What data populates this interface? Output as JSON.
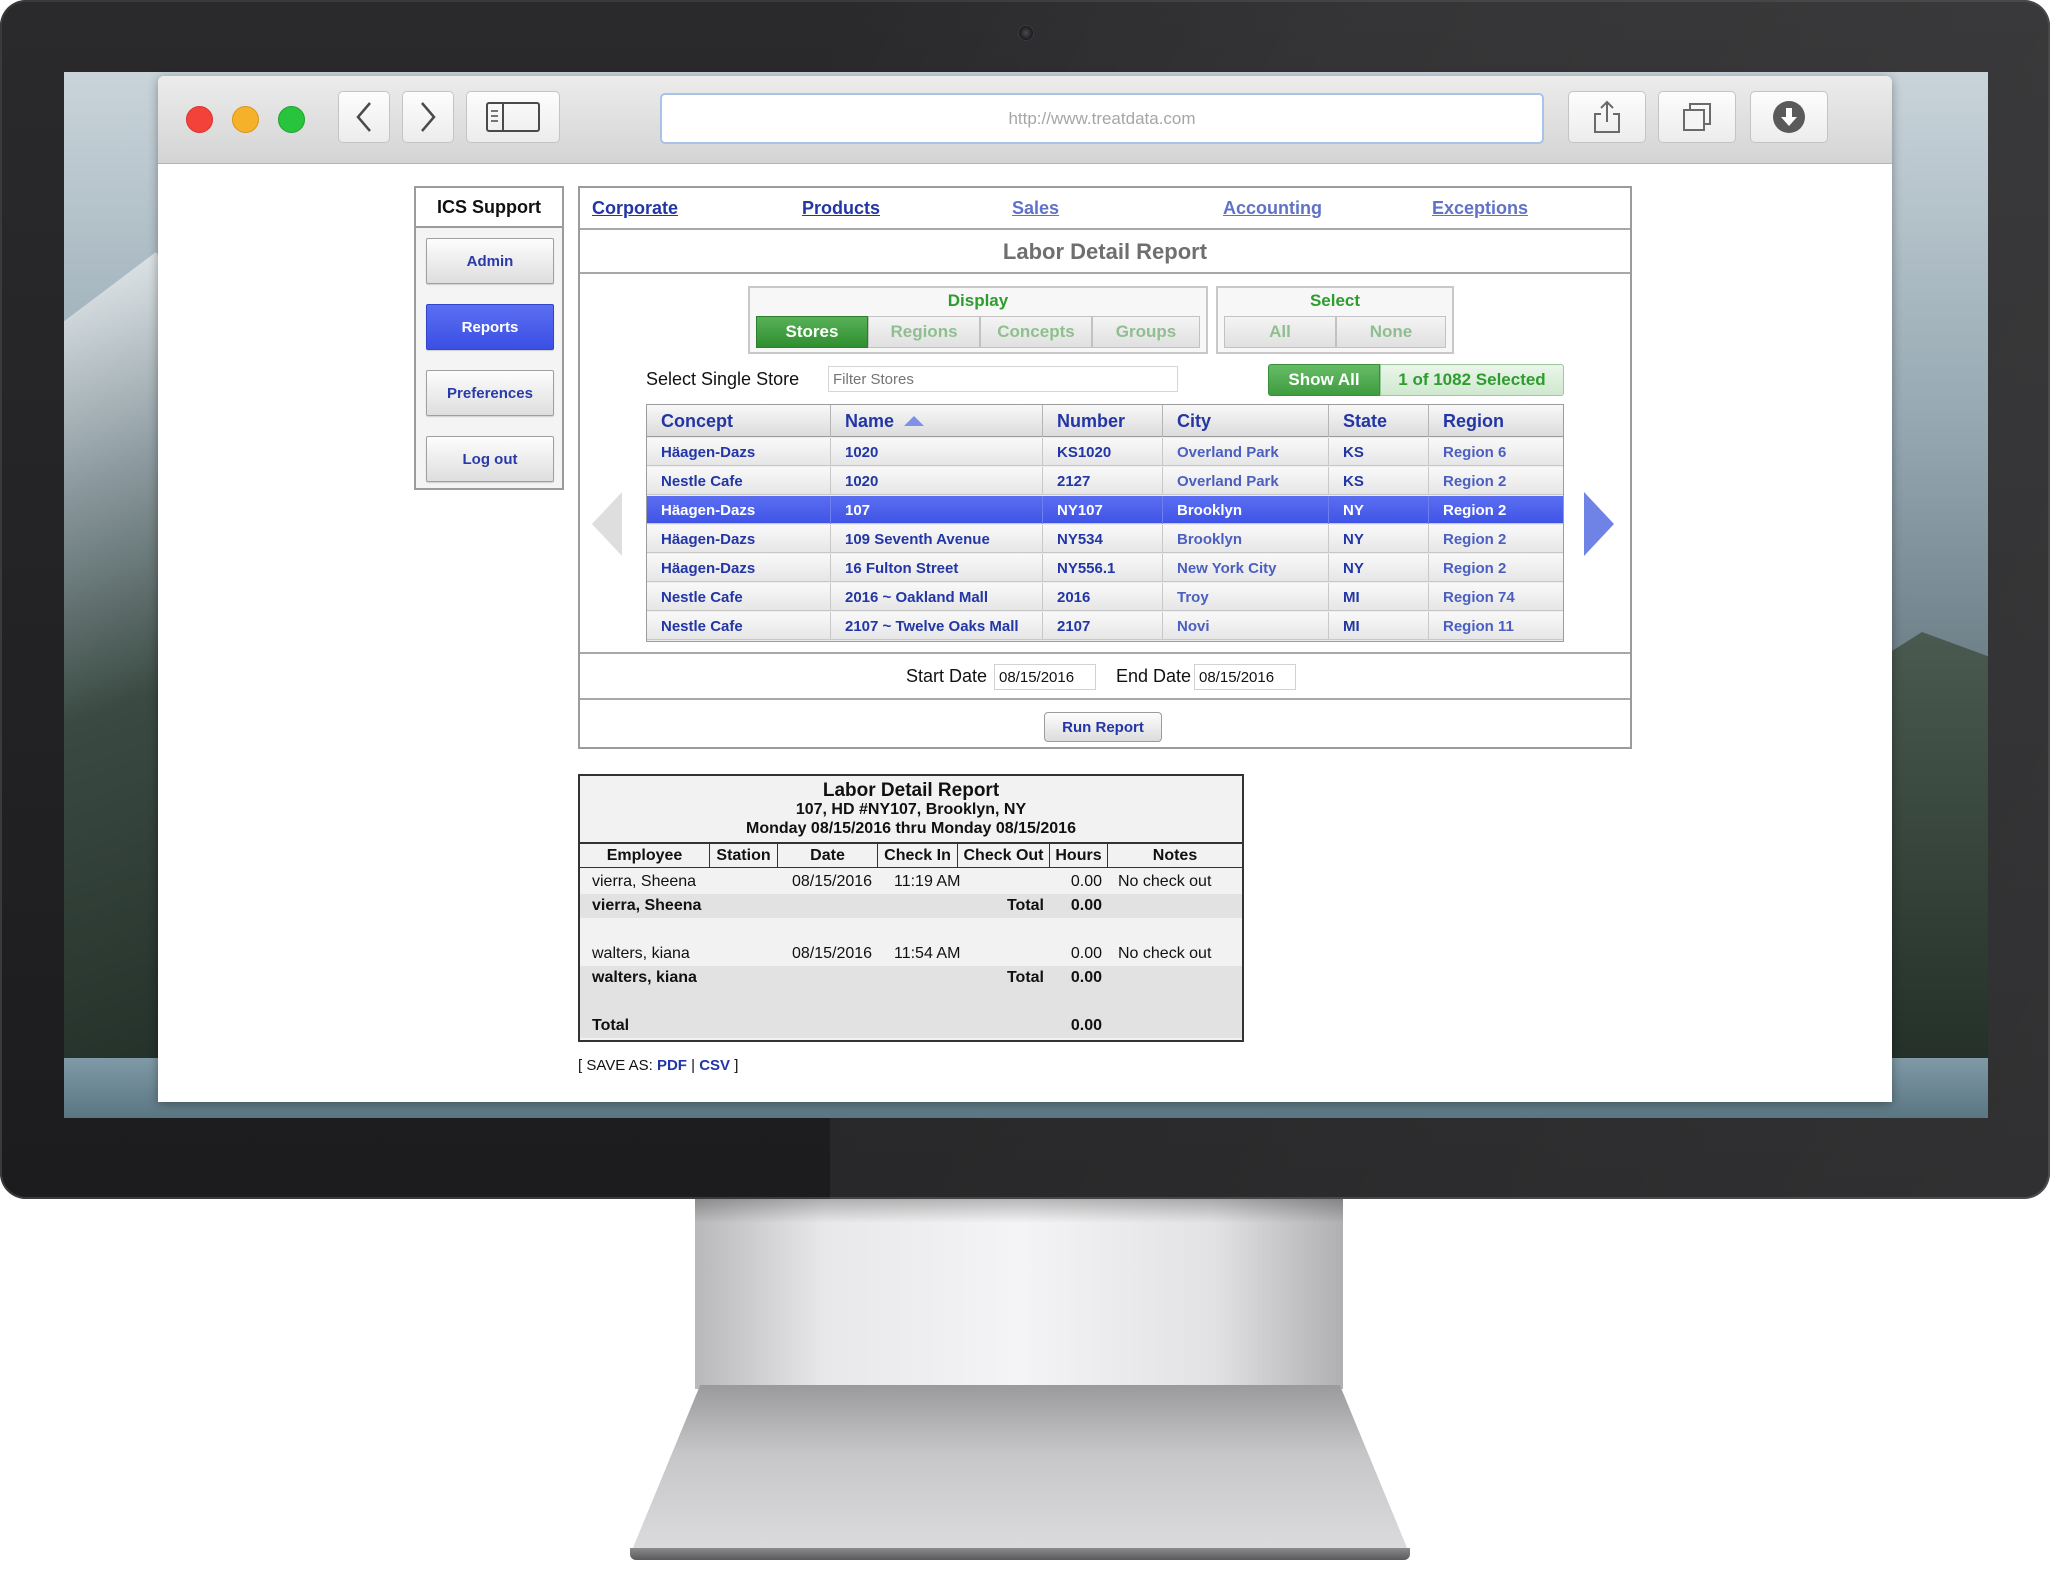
{
  "browser": {
    "url": "http://www.treatdata.com"
  },
  "sidebar": {
    "title": "ICS Support",
    "items": [
      {
        "label": "Admin",
        "active": false
      },
      {
        "label": "Reports",
        "active": true
      },
      {
        "label": "Preferences",
        "active": false
      },
      {
        "label": "Log out",
        "active": false
      }
    ]
  },
  "nav": {
    "items": [
      "Corporate",
      "Products",
      "Sales",
      "Accounting",
      "Exceptions"
    ]
  },
  "page_title": "Labor Detail Report",
  "display_group": {
    "title": "Display",
    "options": [
      "Stores",
      "Regions",
      "Concepts",
      "Groups"
    ],
    "selected": "Stores"
  },
  "select_group": {
    "title": "Select",
    "options": [
      "All",
      "None"
    ]
  },
  "store_filter": {
    "label": "Select Single Store",
    "placeholder": "Filter Stores",
    "show_all_label": "Show All",
    "selected_count": "1 of 1082 Selected"
  },
  "store_table": {
    "columns": [
      "Concept",
      "Name",
      "Number",
      "City",
      "State",
      "Region"
    ],
    "sort_column": "Name",
    "rows": [
      {
        "concept": "Häagen-Dazs",
        "name": "1020",
        "number": "KS1020",
        "city": "Overland Park",
        "state": "KS",
        "region": "Region 6",
        "selected": false
      },
      {
        "concept": "Nestle Cafe",
        "name": "1020",
        "number": "2127",
        "city": "Overland Park",
        "state": "KS",
        "region": "Region 2",
        "selected": false
      },
      {
        "concept": "Häagen-Dazs",
        "name": "107",
        "number": "NY107",
        "city": "Brooklyn",
        "state": "NY",
        "region": "Region 2",
        "selected": true
      },
      {
        "concept": "Häagen-Dazs",
        "name": "109 Seventh Avenue",
        "number": "NY534",
        "city": "Brooklyn",
        "state": "NY",
        "region": "Region 2",
        "selected": false
      },
      {
        "concept": "Häagen-Dazs",
        "name": "16 Fulton Street",
        "number": "NY556.1",
        "city": "New York City",
        "state": "NY",
        "region": "Region 2",
        "selected": false
      },
      {
        "concept": "Nestle Cafe",
        "name": "2016 ~ Oakland Mall",
        "number": "2016",
        "city": "Troy",
        "state": "MI",
        "region": "Region 74",
        "selected": false
      },
      {
        "concept": "Nestle Cafe",
        "name": "2107 ~ Twelve Oaks Mall",
        "number": "2107",
        "city": "Novi",
        "state": "MI",
        "region": "Region 11",
        "selected": false
      }
    ]
  },
  "dates": {
    "start_label": "Start Date",
    "start_value": "08/15/2016",
    "end_label": "End Date",
    "end_value": "08/15/2016"
  },
  "run_button": "Run Report",
  "report": {
    "title": "Labor Detail Report",
    "subtitle": "107, HD #NY107, Brooklyn, NY",
    "period": "Monday 08/15/2016 thru Monday 08/15/2016",
    "columns": [
      "Employee",
      "Station",
      "Date",
      "Check In",
      "Check Out",
      "Hours",
      "Notes"
    ],
    "entries": [
      {
        "employee": "vierra, Sheena",
        "station": "",
        "date": "08/15/2016",
        "check_in": "11:19 AM",
        "check_out": "",
        "hours": "0.00",
        "notes": "No check out"
      },
      {
        "employee": "vierra, Sheena",
        "total_label": "Total",
        "hours": "0.00"
      },
      {
        "employee": "walters, kiana",
        "station": "",
        "date": "08/15/2016",
        "check_in": "11:54 AM",
        "check_out": "",
        "hours": "0.00",
        "notes": "No check out"
      },
      {
        "employee": "walters, kiana",
        "total_label": "Total",
        "hours": "0.00"
      }
    ],
    "grand_total_label": "Total",
    "grand_total_hours": "0.00"
  },
  "save_as": {
    "prefix": "[ SAVE AS:",
    "pdf": "PDF",
    "separator": "|",
    "csv": "CSV",
    "suffix": "]"
  }
}
